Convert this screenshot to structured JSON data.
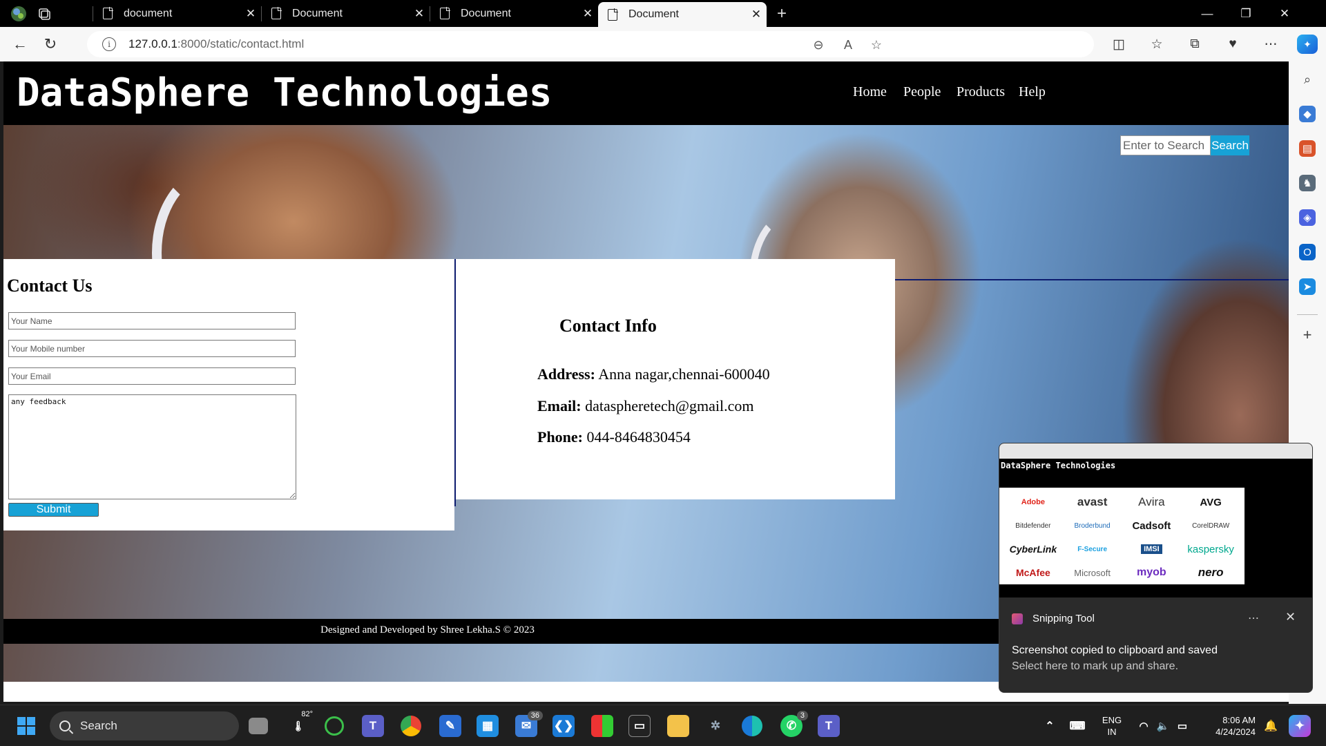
{
  "browser": {
    "tabs": [
      {
        "label": "document",
        "active": false
      },
      {
        "label": "Document",
        "active": false
      },
      {
        "label": "Document",
        "active": false
      },
      {
        "label": "Document",
        "active": true
      }
    ],
    "url_host": "127.0.0.1",
    "url_rest": ":8000/static/contact.html"
  },
  "site": {
    "title": "DataSphere Technologies",
    "nav": [
      "Home",
      "People",
      "Products",
      "Help"
    ],
    "search": {
      "placeholder": "Enter to Search",
      "button": "Search"
    },
    "contact": {
      "heading": "Contact Us",
      "name_placeholder": "Your Name",
      "mobile_placeholder": "Your Mobile number",
      "email_placeholder": "Your Email",
      "feedback_value": "any feedback",
      "submit": "Submit"
    },
    "info": {
      "heading": "Contact Info",
      "address_label": "Address:",
      "address_value": " Anna nagar,chennai-600040",
      "email_label": "Email:",
      "email_value": " dataspheretech@gmail.com",
      "phone_label": "Phone:",
      "phone_value": " 044-8464830454"
    },
    "footer": "Designed and Developed by Shree Lekha.S © 2023"
  },
  "toast": {
    "app": "Snipping Tool",
    "title": "Screenshot copied to clipboard and saved",
    "body": "Select here to mark up and share.",
    "thumb_title": "DataSphere Technologies",
    "logos": [
      "Adobe",
      "avast",
      "Avira",
      "AVG",
      "Bitdefender",
      "Broderbund",
      "Cadsoft",
      "CorelDRAW",
      "CyberLink",
      "F-Secure",
      "IMSI",
      "kaspersky",
      "McAfee",
      "Microsoft",
      "myob",
      "nero"
    ]
  },
  "taskbar": {
    "search": "Search",
    "weather": "82°",
    "badge_teams": "36",
    "badge_whatsapp": "3",
    "lang_top": "ENG",
    "lang_bottom": "IN",
    "time": "8:06 AM",
    "date": "4/24/2024"
  },
  "colors": {
    "accent": "#17a2d6",
    "header_bg": "#000000",
    "divider": "#0b1a6e"
  }
}
